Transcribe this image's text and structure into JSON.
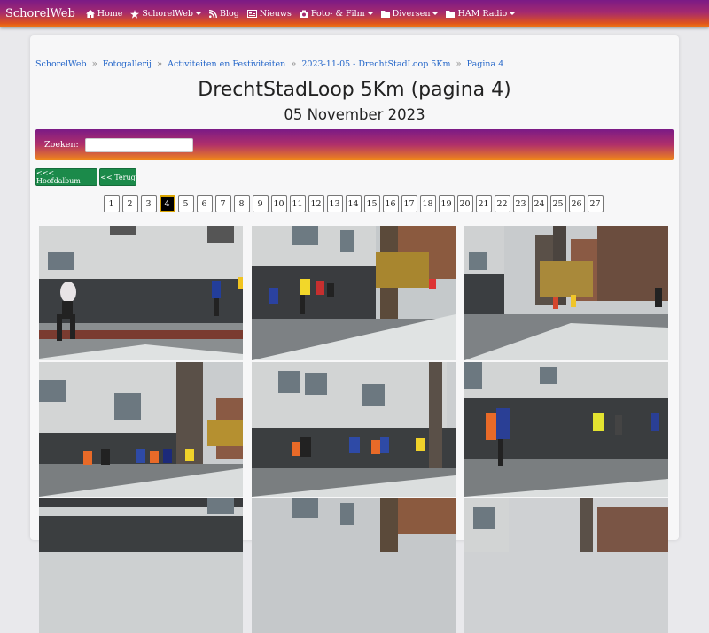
{
  "navbar": {
    "brand": "SchorelWeb",
    "items": [
      {
        "label": "Home",
        "icon": "home-icon",
        "dropdown": false
      },
      {
        "label": "SchorelWeb",
        "icon": "star-icon",
        "dropdown": true
      },
      {
        "label": "Blog",
        "icon": "rss-icon",
        "dropdown": false
      },
      {
        "label": "Nieuws",
        "icon": "newspaper-icon",
        "dropdown": false
      },
      {
        "label": "Foto- & Film",
        "icon": "camera-icon",
        "dropdown": true
      },
      {
        "label": "Diversen",
        "icon": "folder-icon",
        "dropdown": true
      },
      {
        "label": "HAM Radio",
        "icon": "folder-icon",
        "dropdown": true
      }
    ]
  },
  "breadcrumb": [
    "SchorelWeb",
    "Fotogallerij",
    "Activiteiten en Festiviteiten",
    "2023-11-05 - DrechtStadLoop 5Km",
    "Pagina 4"
  ],
  "page": {
    "title": "DrechtStadLoop 5Km (pagina 4)",
    "date": "05 November 2023"
  },
  "search": {
    "label": "Zoeken:",
    "value": ""
  },
  "buttons": {
    "main_album": "<<< Hoofdalbum",
    "back": "<< Terug"
  },
  "pagination": {
    "pages": [
      "1",
      "2",
      "3",
      "4",
      "5",
      "6",
      "7",
      "8",
      "9",
      "10",
      "11",
      "12",
      "13",
      "14",
      "15",
      "16",
      "17",
      "18",
      "19",
      "20",
      "21",
      "22",
      "23",
      "24",
      "25",
      "26",
      "27"
    ],
    "active": "4"
  }
}
